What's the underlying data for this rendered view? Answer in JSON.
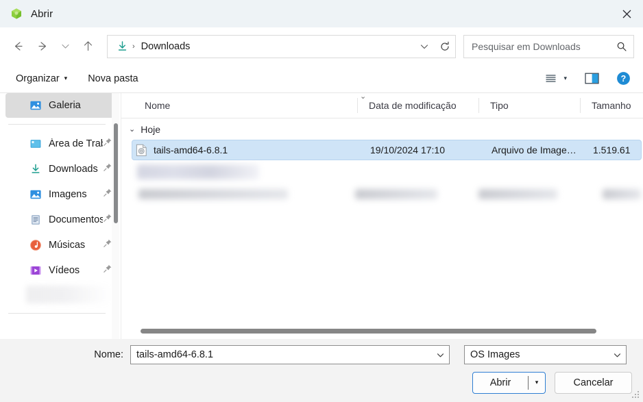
{
  "window": {
    "title": "Abrir",
    "app_icon": "green-cube-icon",
    "close_label": "✕"
  },
  "nav": {
    "back_icon": "←",
    "forward_icon": "→",
    "recent_icon": "⌄",
    "up_icon": "↑",
    "address": {
      "location_icon": "downloads-arrow-icon",
      "separator": "›",
      "crumb": "Downloads",
      "dropdown_icon": "⌄",
      "refresh_icon": "⟳"
    },
    "search": {
      "placeholder": "Pesquisar em Downloads",
      "icon": "search-icon"
    }
  },
  "commandbar": {
    "organize": "Organizar",
    "organize_caret": "▾",
    "new_folder": "Nova pasta",
    "view_icon": "list-view-icon",
    "view_caret": "▾",
    "pane_icon": "preview-pane-icon",
    "help_icon": "?"
  },
  "sidebar": {
    "selected": {
      "label": "Galeria",
      "icon": "gallery-icon"
    },
    "items": [
      {
        "label": "Área de Trab",
        "icon": "desktop-icon",
        "pinned": true
      },
      {
        "label": "Downloads",
        "icon": "downloads-icon",
        "pinned": true
      },
      {
        "label": "Imagens",
        "icon": "pictures-icon",
        "pinned": true
      },
      {
        "label": "Documentos",
        "icon": "documents-icon",
        "pinned": true
      },
      {
        "label": "Músicas",
        "icon": "music-icon",
        "pinned": true
      },
      {
        "label": "Vídeos",
        "icon": "videos-icon",
        "pinned": true
      }
    ],
    "pin_glyph": "📌"
  },
  "filelist": {
    "columns": {
      "name": "Nome",
      "date": "Data de modificação",
      "type": "Tipo",
      "size": "Tamanho"
    },
    "sort_indicator": "⌄",
    "groups": [
      {
        "label": "Hoje",
        "chevron": "⌄",
        "rows": [
          {
            "name": "tails-amd64-6.8.1",
            "date": "19/10/2024 17:10",
            "type": "Arquivo de Image…",
            "size": "1.519.61",
            "icon": "iso-image-file-icon",
            "selected": true
          }
        ]
      }
    ]
  },
  "footer": {
    "filename_label": "Nome:",
    "filename_value": "tails-amd64-6.8.1",
    "filetype_value": "OS Images",
    "chevron": "⌄",
    "open_button": "Abrir",
    "open_caret": "▾",
    "cancel_button": "Cancelar"
  },
  "colors": {
    "titlebar_bg": "#eef3f6",
    "selection": "#cfe4f7",
    "accent": "#2d7dd2",
    "downloads_accent": "#1d9e8f"
  }
}
